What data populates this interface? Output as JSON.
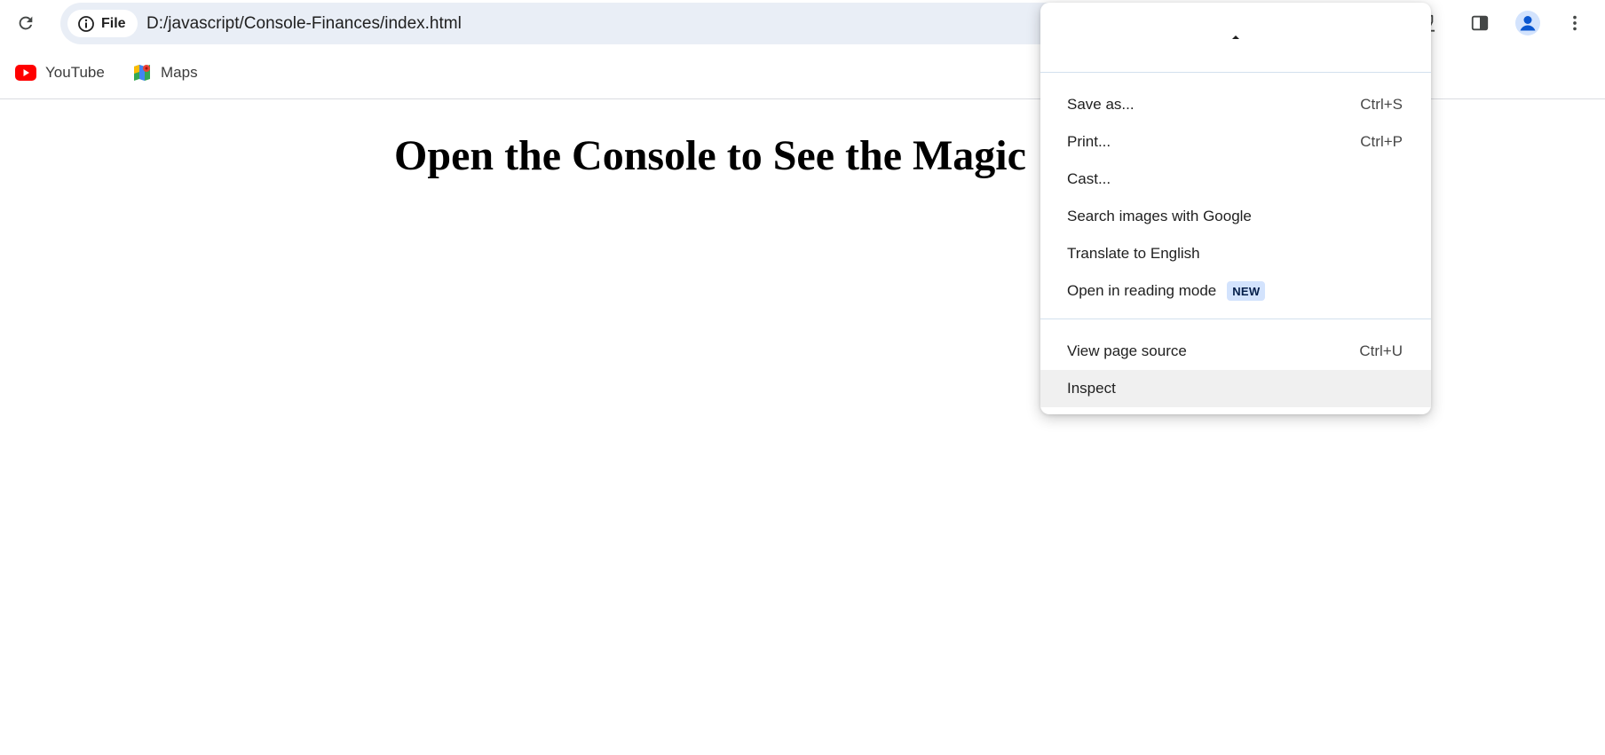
{
  "colors": {
    "omnibox_bg": "#e9eef6",
    "menu_separator": "#d3e0ee",
    "menu_hover": "#f0f0f0",
    "badge_bg": "#d3e3fd",
    "badge_text": "#041e49",
    "youtube_red": "#ff0000",
    "profile_blue": "#0b57d0"
  },
  "toolbar": {
    "reload_icon": "reload-icon",
    "site_info_icon": "info-icon",
    "site_chip_label": "File",
    "url": "D:/javascript/Console-Finances/index.html",
    "labs_icon": "labs-flask-icon",
    "side_panel_icon": "side-panel-icon",
    "profile_icon": "profile-avatar-icon",
    "menu_icon": "more-vert-icon"
  },
  "bookmarks": [
    {
      "label": "YouTube",
      "icon": "youtube-icon"
    },
    {
      "label": "Maps",
      "icon": "google-maps-icon"
    }
  ],
  "page": {
    "heading": "Open the Console to See the Magic"
  },
  "context_menu": {
    "scroll_icon": "scroll-up-arrow-icon",
    "items": [
      {
        "label": "Save as...",
        "shortcut": "Ctrl+S"
      },
      {
        "label": "Print...",
        "shortcut": "Ctrl+P"
      },
      {
        "label": "Cast...",
        "shortcut": ""
      },
      {
        "label": "Search images with Google",
        "shortcut": ""
      },
      {
        "label": "Translate to English",
        "shortcut": ""
      },
      {
        "label": "Open in reading mode",
        "badge": "NEW",
        "shortcut": ""
      },
      {
        "label": "View page source",
        "shortcut": "Ctrl+U"
      },
      {
        "label": "Inspect",
        "shortcut": "",
        "highlighted": true
      }
    ]
  }
}
